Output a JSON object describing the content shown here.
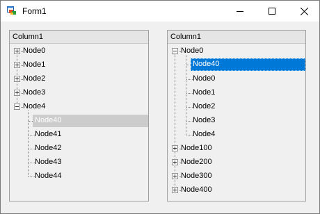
{
  "window": {
    "title": "Form1"
  },
  "left_tree": {
    "column_header": "Column1",
    "nodes": [
      "Node0",
      "Node1",
      "Node2",
      "Node3",
      "Node4"
    ],
    "children": [
      "Node40",
      "Node41",
      "Node42",
      "Node43",
      "Node44"
    ],
    "selected": "Node40"
  },
  "right_tree": {
    "column_header": "Column1",
    "root": "Node0",
    "children": [
      "Node40",
      "Node0",
      "Node1",
      "Node2",
      "Node3",
      "Node4"
    ],
    "siblings": [
      "Node100",
      "Node200",
      "Node300",
      "Node400"
    ],
    "selected": "Node40"
  },
  "colors": {
    "selection_blue": "#0078d7",
    "selection_gray": "#cccccc"
  }
}
